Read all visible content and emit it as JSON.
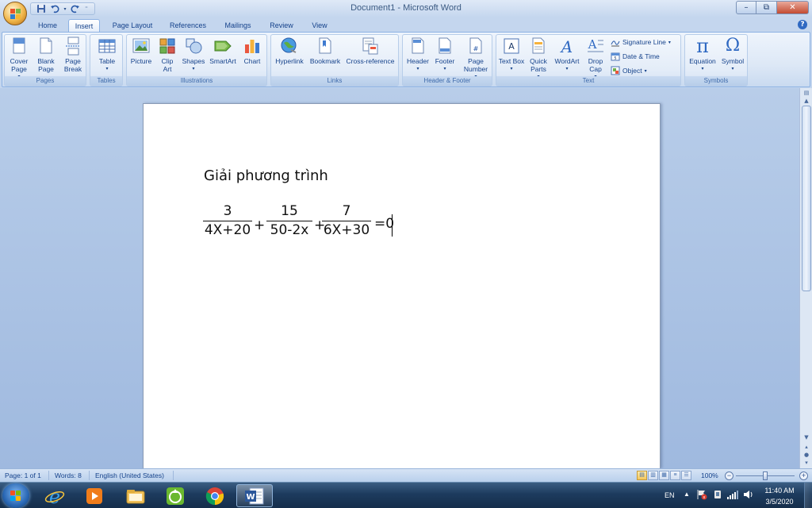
{
  "window": {
    "title": "Document1 - Microsoft Word",
    "minimize_glyph": "–",
    "restore_glyph": "⧉",
    "close_glyph": "✕"
  },
  "quick_access": {
    "save_icon": "save-icon",
    "undo_icon": "undo-icon",
    "redo_icon": "redo-icon",
    "customize_icon": "customize-qat-icon"
  },
  "tabs": [
    "Home",
    "Insert",
    "Page Layout",
    "References",
    "Mailings",
    "Review",
    "View"
  ],
  "active_tab": "Insert",
  "ribbon": {
    "pages": {
      "label": "Pages",
      "cover_page": "Cover Page",
      "blank_page": "Blank Page",
      "page_break": "Page Break"
    },
    "tables": {
      "label": "Tables",
      "table": "Table"
    },
    "illustrations": {
      "label": "Illustrations",
      "picture": "Picture",
      "clip_art": "Clip Art",
      "shapes": "Shapes",
      "smartart": "SmartArt",
      "chart": "Chart"
    },
    "links": {
      "label": "Links",
      "hyperlink": "Hyperlink",
      "bookmark": "Bookmark",
      "cross_reference": "Cross-reference"
    },
    "header_footer": {
      "label": "Header & Footer",
      "header": "Header",
      "footer": "Footer",
      "page_number": "Page Number"
    },
    "text": {
      "label": "Text",
      "text_box": "Text Box",
      "quick_parts": "Quick Parts",
      "wordart": "WordArt",
      "drop_cap": "Drop Cap",
      "signature_line": "Signature Line",
      "date_time": "Date & Time",
      "object": "Object"
    },
    "symbols": {
      "label": "Symbols",
      "equation": "Equation",
      "symbol": "Symbol",
      "pi_glyph": "π",
      "omega_glyph": "Ω"
    }
  },
  "document": {
    "heading": "Giải phương trình",
    "equation": {
      "fractions": [
        {
          "numerator": "3",
          "denominator": "4X+20"
        },
        {
          "numerator": "15",
          "denominator": "50-2x"
        },
        {
          "numerator": "7",
          "denominator": "6X+30"
        }
      ],
      "plus": "+",
      "equals_zero": "=0"
    }
  },
  "statusbar": {
    "page": "Page: 1 of 1",
    "words": "Words: 8",
    "language": "English (United States)",
    "zoom": "100%"
  },
  "taskbar": {
    "apps": [
      "internet-explorer-icon",
      "media-player-icon",
      "file-explorer-icon",
      "app-green-icon",
      "chrome-icon",
      "word-icon"
    ],
    "language": "EN",
    "time": "11:40 AM",
    "date": "3/5/2020"
  },
  "colors": {
    "ribbon_text": "#15428b",
    "chrome_red": "#db4437",
    "chrome_yellow": "#f4c20d",
    "chrome_green": "#0f9d58",
    "chrome_blue": "#4285f4",
    "word_blue": "#2b579a"
  }
}
